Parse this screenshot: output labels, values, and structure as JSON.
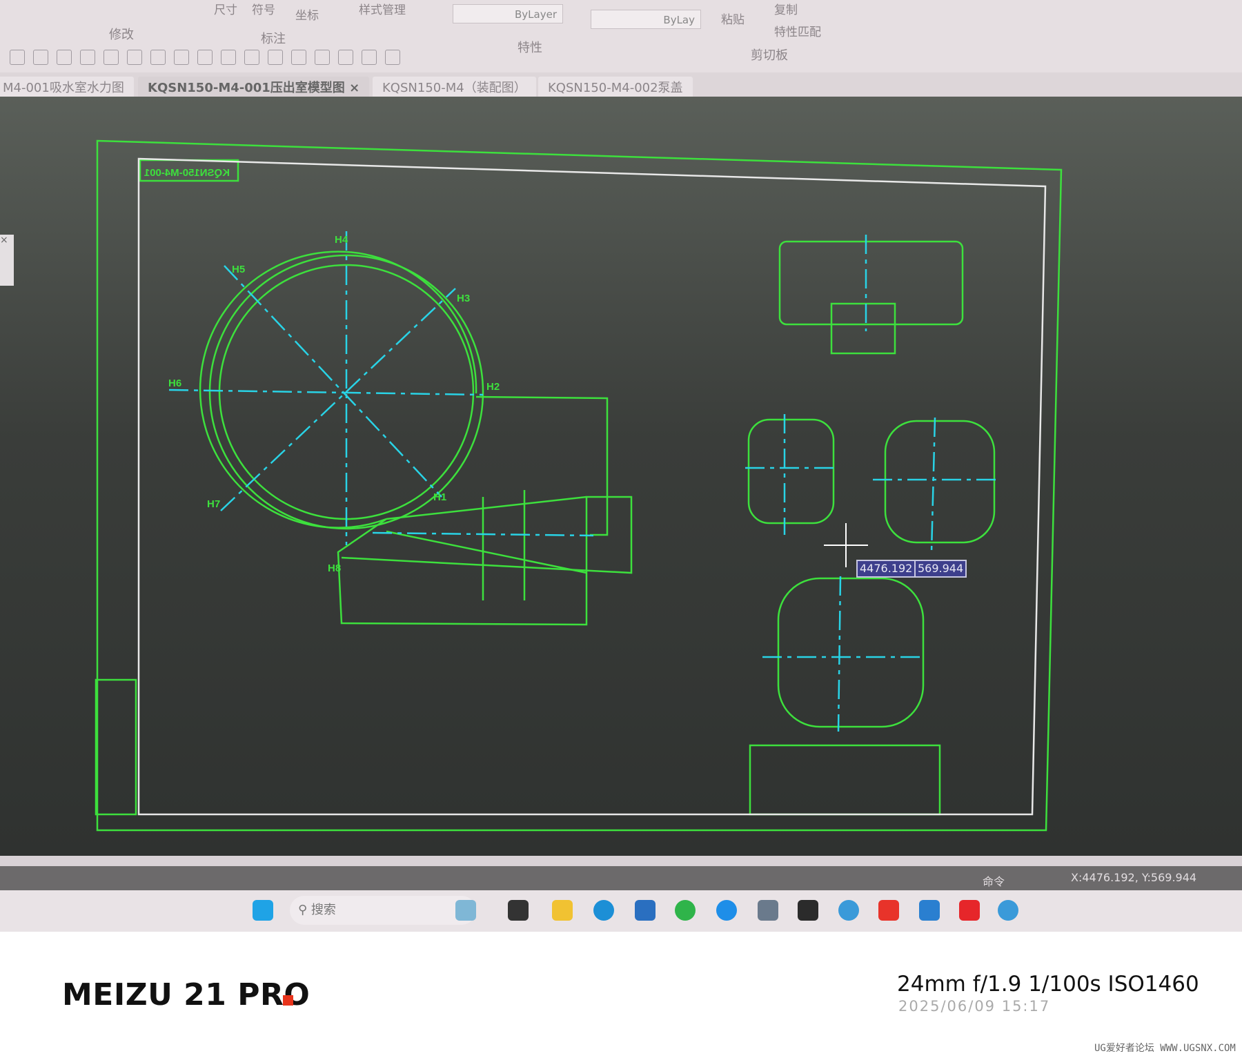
{
  "ribbon": {
    "groups": [
      "修改",
      "标注",
      "特性",
      "剪切板"
    ],
    "tools": {
      "dimension": "尺寸",
      "symbol": "符号",
      "coordinate": "坐标",
      "style_manager": "样式管理",
      "paste": "粘贴",
      "copy": "复制",
      "match_properties": "特性匹配"
    },
    "linetype": "ByLayer",
    "lineweight": "ByLay"
  },
  "tabs": [
    {
      "label": "M4-001吸水室水力图",
      "active": false
    },
    {
      "label": "KQSN150-M4-001压出室模型图",
      "active": true,
      "close": "×"
    },
    {
      "label": "KQSN150-M4（装配图）",
      "active": false
    },
    {
      "label": "KQSN150-M4-002泵盖",
      "active": false
    }
  ],
  "drawing": {
    "title_block_mirrored": "KQSN150-M4-001",
    "labels": [
      "H1",
      "H2",
      "H3",
      "H4",
      "H5",
      "H6",
      "H7",
      "H8"
    ],
    "cursor_x": "4476.192",
    "cursor_y": "569.944",
    "colors": {
      "geometry": "#3de03d",
      "centerline": "#29d3e6",
      "frame": "#e8e8e8"
    }
  },
  "side_handle": "×",
  "status": {
    "command": "命令",
    "coords": "X:4476.192, Y:569.944"
  },
  "taskbar": {
    "search_placeholder": "搜索",
    "icons": [
      "windows-start",
      "beach-widget",
      "terminal",
      "file-explorer",
      "edge",
      "store",
      "wechat",
      "feishu",
      "calculator",
      "app-y",
      "ug-nx",
      "wps",
      "qq-browser",
      "ting",
      "ug-nx-2"
    ]
  },
  "photo": {
    "device": "MEIZU 21 PRO",
    "exif": "24mm  f/1.9  1/100s  ISO1460",
    "datetime": "2025/06/09  15:17",
    "watermark": "UG爱好者论坛 WWW.UGSNX.COM"
  }
}
